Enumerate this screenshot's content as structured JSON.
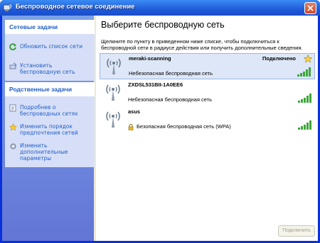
{
  "window": {
    "title": "Беспроводное сетевое соединение"
  },
  "sidebar": {
    "network_tasks": {
      "heading": "Сетевые задачи",
      "items": [
        {
          "label": "Обновить список сети",
          "icon": "refresh-icon"
        },
        {
          "label": "Установить беспроводную сеть",
          "icon": "wireless-setup-icon"
        }
      ]
    },
    "related_tasks": {
      "heading": "Родственные задачи",
      "items": [
        {
          "label": "Подробнее о беспроводных сетях",
          "icon": "info-icon"
        },
        {
          "label": "Изменить порядок предпочтения сетей",
          "icon": "star-icon"
        },
        {
          "label": "Изменить дополнительные параметры",
          "icon": "settings-icon"
        }
      ]
    }
  },
  "main": {
    "title": "Выберите беспроводную сеть",
    "description": "Щелкните по пункту в приведенном ниже списке, чтобы подключиться к беспроводной сети в радиусе действия или получить дополнительные сведения.",
    "networks": [
      {
        "name": "meraki-scanning",
        "security": "Небезопасная беспроводная сеть",
        "status": "Подключено",
        "signal_bars": 5,
        "preferred": true,
        "secured": false
      },
      {
        "name": "ZXDSL531BII-1A0EE6",
        "security": "Небезопасная беспроводная сеть",
        "status": "",
        "signal_bars": 5,
        "preferred": false,
        "secured": false
      },
      {
        "name": "asus",
        "security": "Безопасная беспроводная сеть (WPA)",
        "status": "",
        "signal_bars": 5,
        "preferred": false,
        "secured": true
      }
    ],
    "connect_button": "Подключить"
  },
  "colors": {
    "titlebar": "#2b6fe4",
    "sidebar_link": "#215dc6",
    "selected_row": "#dde7f7",
    "signal_bar": "#3ea63a"
  }
}
